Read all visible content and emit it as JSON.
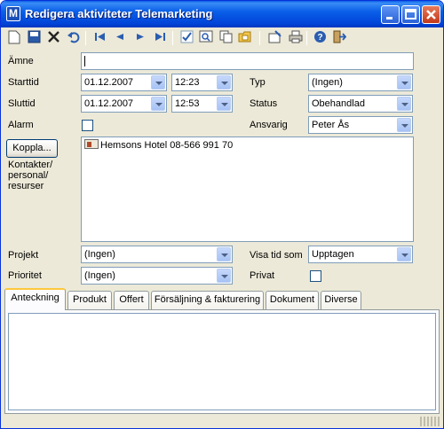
{
  "window": {
    "title": "Redigera aktiviteter Telemarketing",
    "app_icon_letter": "M",
    "controls": [
      "minimize-icon",
      "maximize-icon",
      "close-icon"
    ]
  },
  "toolbar": {
    "icons": [
      "new-icon",
      "save-icon",
      "delete-icon",
      "undo-icon",
      "first-record-icon",
      "previous-record-icon",
      "next-record-icon",
      "last-record-icon",
      "check-icon",
      "search-icon",
      "copy-icon",
      "folder-icon",
      "properties-icon",
      "print-icon",
      "help-icon",
      "exit-icon"
    ]
  },
  "form": {
    "subject_label": "Ämne",
    "subject_value": "",
    "start_label": "Starttid",
    "start_date": "01.12.2007",
    "start_time": "12:23",
    "end_label": "Sluttid",
    "end_date": "01.12.2007",
    "end_time": "12:53",
    "alarm_label": "Alarm",
    "type_label": "Typ",
    "type_value": "(Ingen)",
    "status_label": "Status",
    "status_value": "Obehandlad",
    "responsible_label": "Ansvarig",
    "responsible_value": "Peter Ås",
    "link_button": "Koppla...",
    "contacts_label": "Kontakter/ personal/ resurser",
    "contacts": [
      "Hemsons Hotel 08-566 991 70"
    ],
    "project_label": "Projekt",
    "project_value": "(Ingen)",
    "show_time_label": "Visa tid som",
    "show_time_value": "Upptagen",
    "priority_label": "Prioritet",
    "priority_value": "(Ingen)",
    "private_label": "Privat"
  },
  "tabs": [
    {
      "label": "Anteckning",
      "active": true
    },
    {
      "label": "Produkt"
    },
    {
      "label": "Offert"
    },
    {
      "label": "Försäljning & fakturering"
    },
    {
      "label": "Dokument"
    },
    {
      "label": "Diverse"
    }
  ],
  "colors": {
    "title_bar": "#0a5fe8",
    "window_bg": "#ece9d8",
    "active_tab_accent": "#ffc83c"
  }
}
